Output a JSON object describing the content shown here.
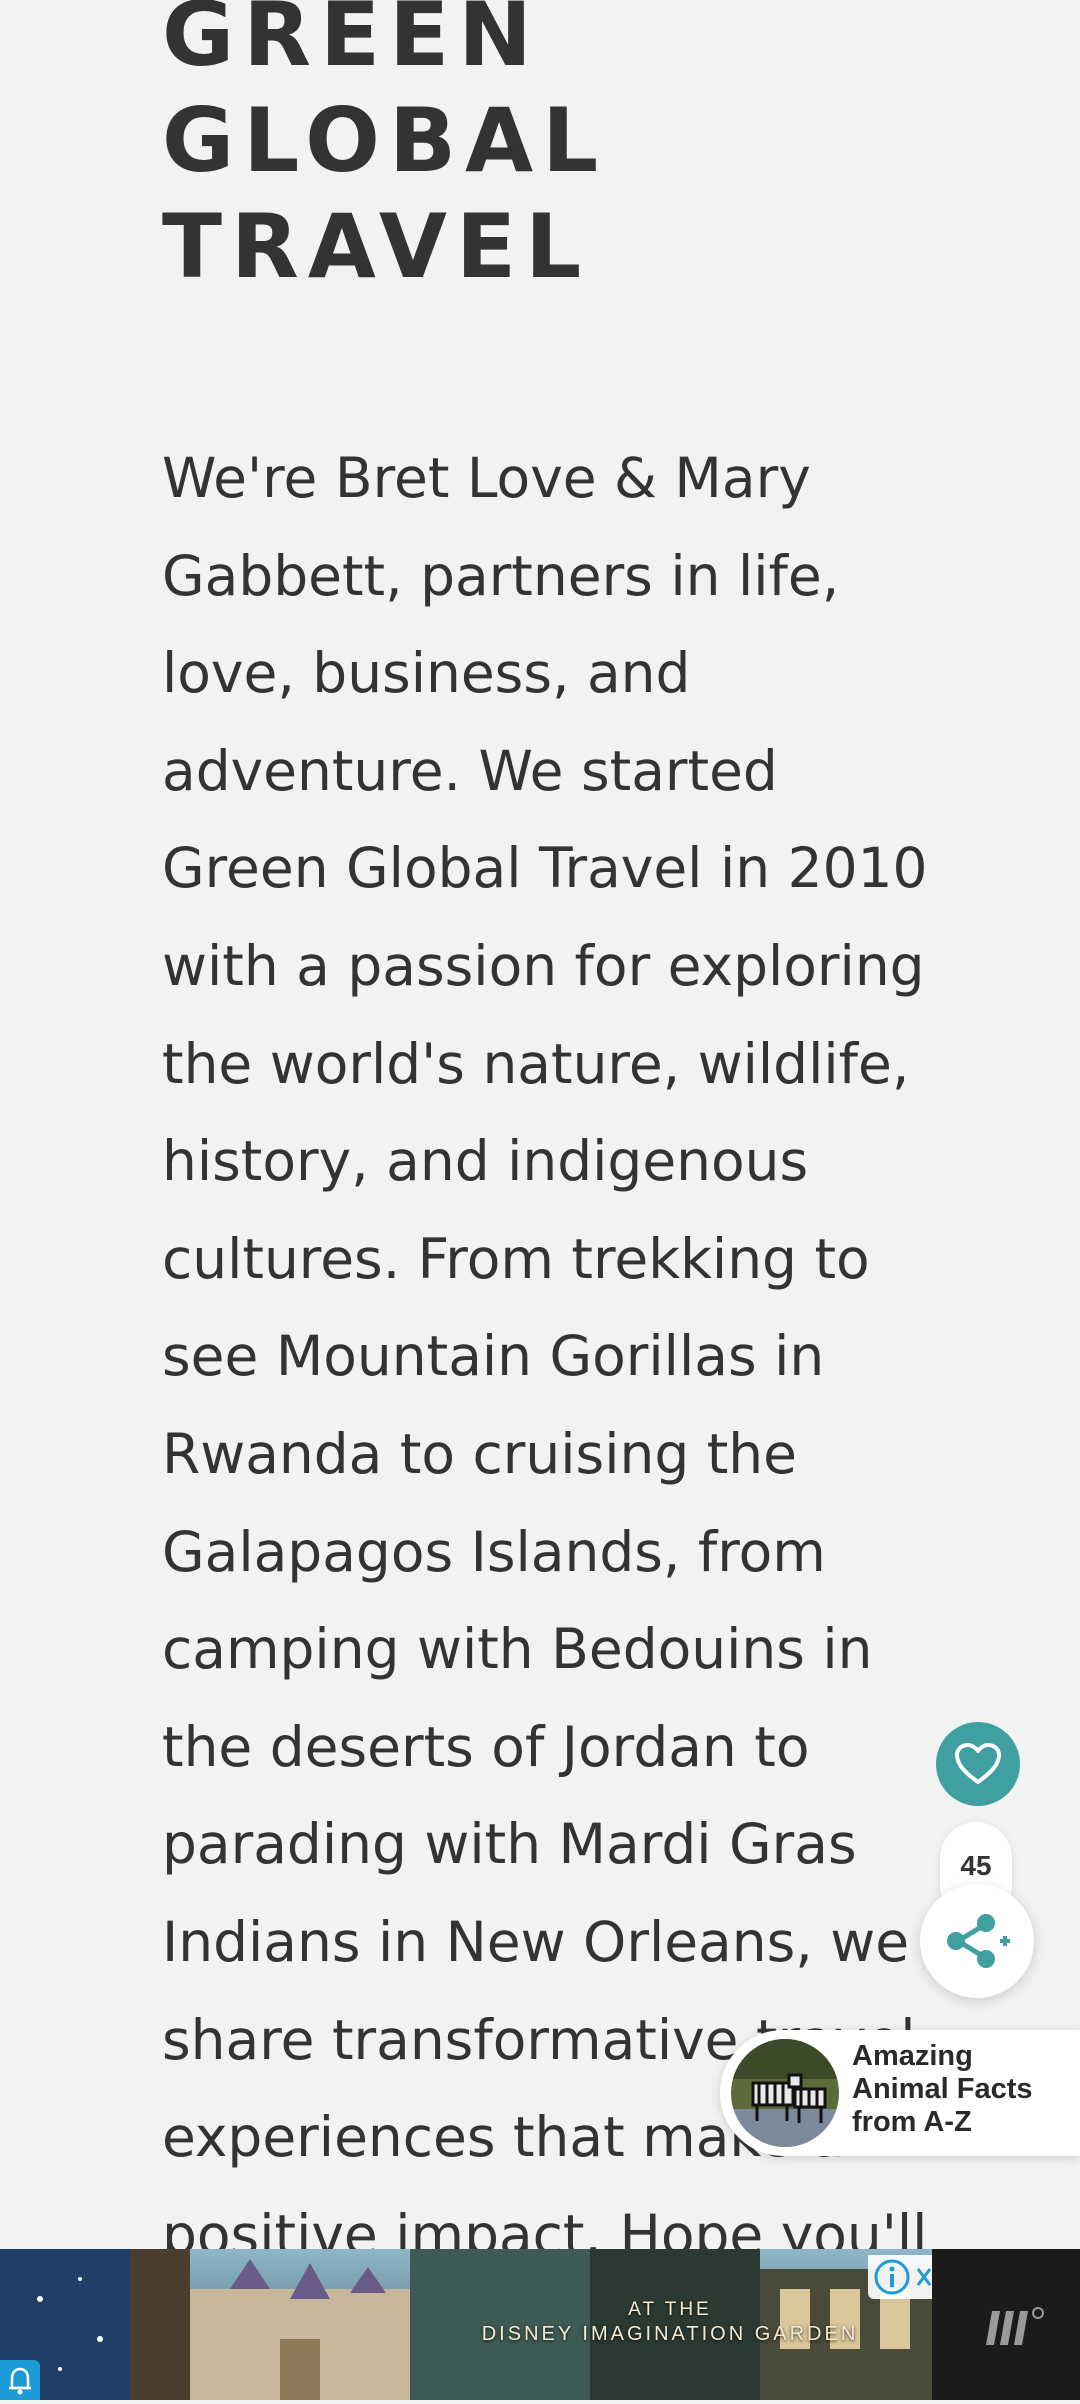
{
  "site": {
    "title_lines": [
      "GREEN",
      "GLOBAL",
      "TRAVEL"
    ]
  },
  "about": {
    "lines": [
      "We're Bret Love & Mary",
      "Gabbett, partners in life,",
      "love, business, and",
      "adventure. We started",
      "Green Global Travel in 2010",
      "with a passion for exploring",
      "the world's nature, wildlife,",
      "history, and indigenous",
      "cultures. From trekking to",
      "see Mountain Gorillas in",
      "Rwanda to cruising the",
      "Galapagos Islands, from",
      "camping with Bedouins in",
      "the deserts of Jordan to",
      "parading with Mardi Gras",
      "Indians in New Orleans, we",
      "share transformative travel",
      "experiences that make a",
      "positive impact. Hope you'll"
    ]
  },
  "floating_actions": {
    "favorite_icon": "heart-icon",
    "share_count": "45",
    "share_icon": "share-icon"
  },
  "promo": {
    "lines": [
      "Amazing",
      "Animal Facts",
      "from A-Z"
    ]
  },
  "ad": {
    "caption_line1": "AT THE",
    "caption_line2": "DISNEY IMAGINATION GARDEN",
    "info_icon": "info-icon",
    "close_icon": "close-icon",
    "brand_icon": "mediavine-logo-icon",
    "notification_icon": "bell-icon"
  },
  "colors": {
    "background": "#f1f2f2",
    "text": "#333333",
    "accent_teal": "#3f9fa1",
    "info_blue": "#1c9bd6"
  }
}
